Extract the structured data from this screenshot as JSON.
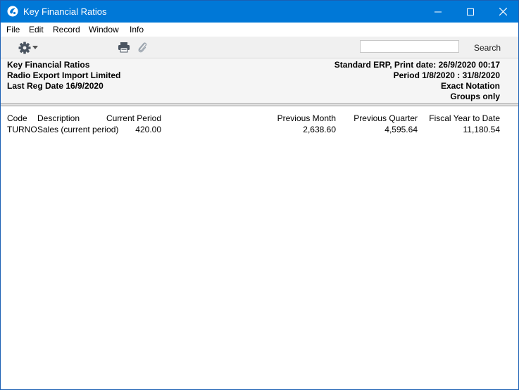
{
  "window": {
    "title": "Key Financial Ratios"
  },
  "menu": {
    "items": [
      "File",
      "Edit",
      "Record",
      "Window",
      "Info"
    ]
  },
  "toolbar": {
    "search_value": "",
    "search_label": "Search"
  },
  "report": {
    "left": [
      "Key Financial Ratios",
      "Radio Export Import Limited",
      "Last Reg Date   16/9/2020"
    ],
    "right": [
      "Standard ERP, Print date: 26/9/2020 00:17",
      "Period   1/8/2020 : 31/8/2020",
      "Exact Notation",
      "Groups only"
    ]
  },
  "table": {
    "headers": {
      "code": "Code",
      "description": "Description",
      "current": "Current Period",
      "prev_month": "Previous Month",
      "prev_quarter": "Previous Quarter",
      "fiscal_ytd": "Fiscal Year to Date"
    },
    "rows": [
      {
        "code": "TURNO",
        "description": "Sales (current period)",
        "current": "420.00",
        "prev_month": "2,638.60",
        "prev_quarter": "4,595.64",
        "fiscal_ytd": "11,180.54"
      }
    ]
  }
}
